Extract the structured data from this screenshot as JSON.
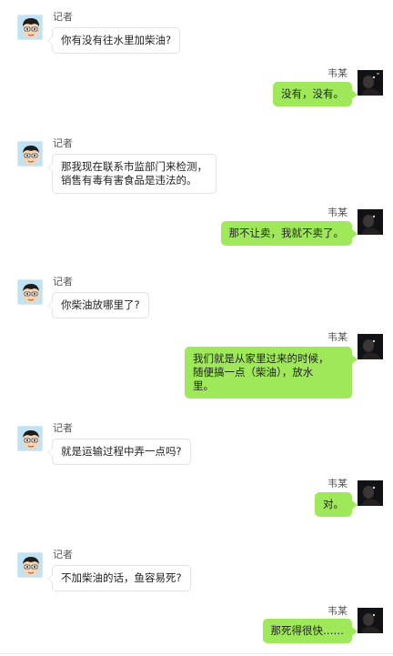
{
  "colors": {
    "right_bubble": "#9fe85a",
    "left_bubble": "#ffffff",
    "left_avatar_bg": "#bfe3f3",
    "right_avatar_bg": "#111216"
  },
  "participants": {
    "left": {
      "name": "记者",
      "avatar_icon": "cartoon-boy-avatar-icon"
    },
    "right": {
      "name": "韦某",
      "avatar_icon": "dark-photo-avatar-icon"
    }
  },
  "messages": [
    {
      "side": "left",
      "text": "你有没有往水里加柴油?"
    },
    {
      "side": "right",
      "text": "没有，没有。"
    },
    {
      "side": "left",
      "text": "那我现在联系市监部门来检测，\n销售有毒有害食品是违法的。"
    },
    {
      "side": "right",
      "text": "那不让卖，我就不卖了。"
    },
    {
      "side": "left",
      "text": "你柴油放哪里了?"
    },
    {
      "side": "right",
      "text": "我们就是从家里过来的时候，\n随便搞一点（柴油），放水\n里。"
    },
    {
      "side": "left",
      "text": "就是运输过程中弄一点吗?"
    },
    {
      "side": "right",
      "text": "对。"
    },
    {
      "side": "left",
      "text": "不加柴油的话，鱼容易死?"
    },
    {
      "side": "right",
      "text": "那死得很快……"
    }
  ]
}
